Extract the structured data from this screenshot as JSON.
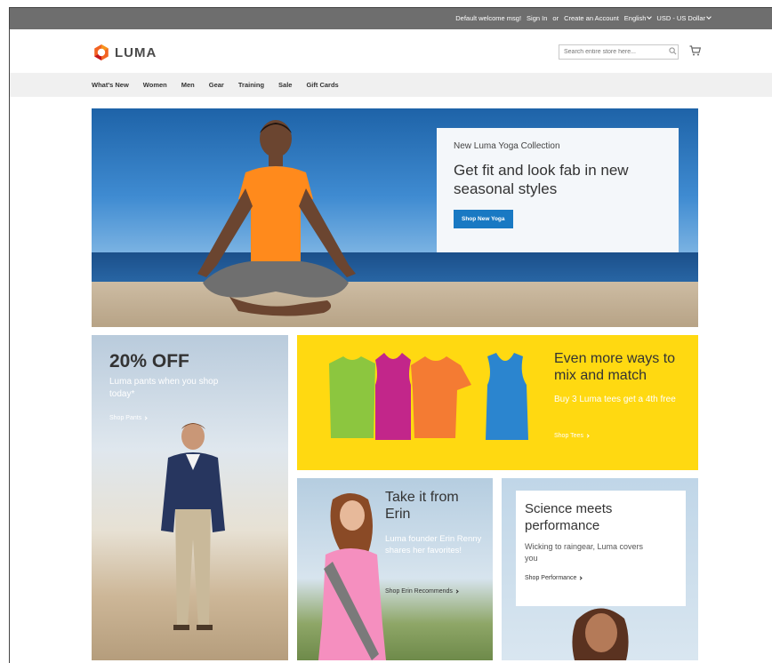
{
  "topbar": {
    "welcome": "Default welcome msg!",
    "sign_in": "Sign In",
    "or": "or",
    "create_account": "Create an Account",
    "language": "English",
    "currency": "USD - US Dollar"
  },
  "header": {
    "logo_text": "LUMA",
    "search_placeholder": "Search entire store here...",
    "icons": [
      "search-icon",
      "cart-icon"
    ]
  },
  "nav": {
    "items": [
      "What's New",
      "Women",
      "Men",
      "Gear",
      "Training",
      "Sale",
      "Gift Cards"
    ]
  },
  "hero": {
    "subtitle": "New Luma Yoga Collection",
    "headline": "Get fit and look fab in new seasonal styles",
    "button": "Shop New Yoga"
  },
  "tiles": {
    "pants": {
      "headline": "20% OFF",
      "desc": "Luma pants when you shop today*",
      "link": "Shop Pants"
    },
    "tees": {
      "headline": "Even more ways to mix and match",
      "desc": "Buy 3 Luma tees get a 4th free",
      "link": "Shop Tees"
    },
    "erin": {
      "headline": "Take it from Erin",
      "desc": "Luma founder Erin Renny shares her favorites!",
      "link": "Shop Erin Recommends"
    },
    "performance": {
      "headline": "Science meets performance",
      "desc": "Wicking to raingear, Luma covers you",
      "link": "Shop Performance"
    }
  },
  "colors": {
    "topbar": "#6e6e6e",
    "accent_blue": "#1979c3",
    "tees_yellow": "#ffd911",
    "logo_orange": "#f26322"
  }
}
